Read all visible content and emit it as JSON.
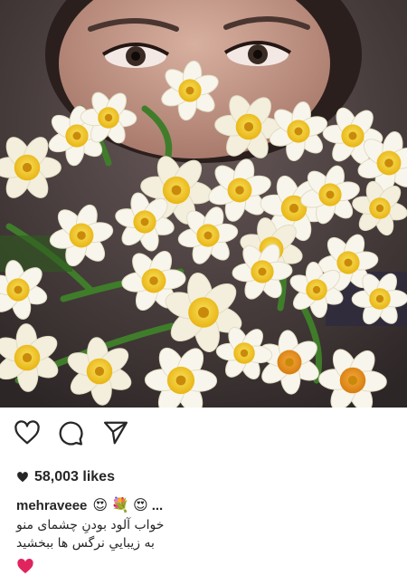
{
  "post": {
    "likes_text": "58,003 likes",
    "username": "mehraveee",
    "caption_emojis": [
      "😍",
      "💐",
      "😍"
    ],
    "caption_ellipsis": "...",
    "caption_lines": [
      "خواب آلود بودنِ چشمای منو",
      "به زیباییِ نرگس ها ببخشید"
    ],
    "caption_end_emoji": "❤️"
  },
  "icons": {
    "like": "heart-outline-icon",
    "comment": "comment-bubble-icon",
    "share": "paper-plane-icon"
  },
  "colors": {
    "text": "#262626",
    "flower_yellow": "#f4c21c",
    "petal_white": "#f7f5ea",
    "stem_green": "#3f7d2a",
    "heart_red": "#e0245e"
  }
}
